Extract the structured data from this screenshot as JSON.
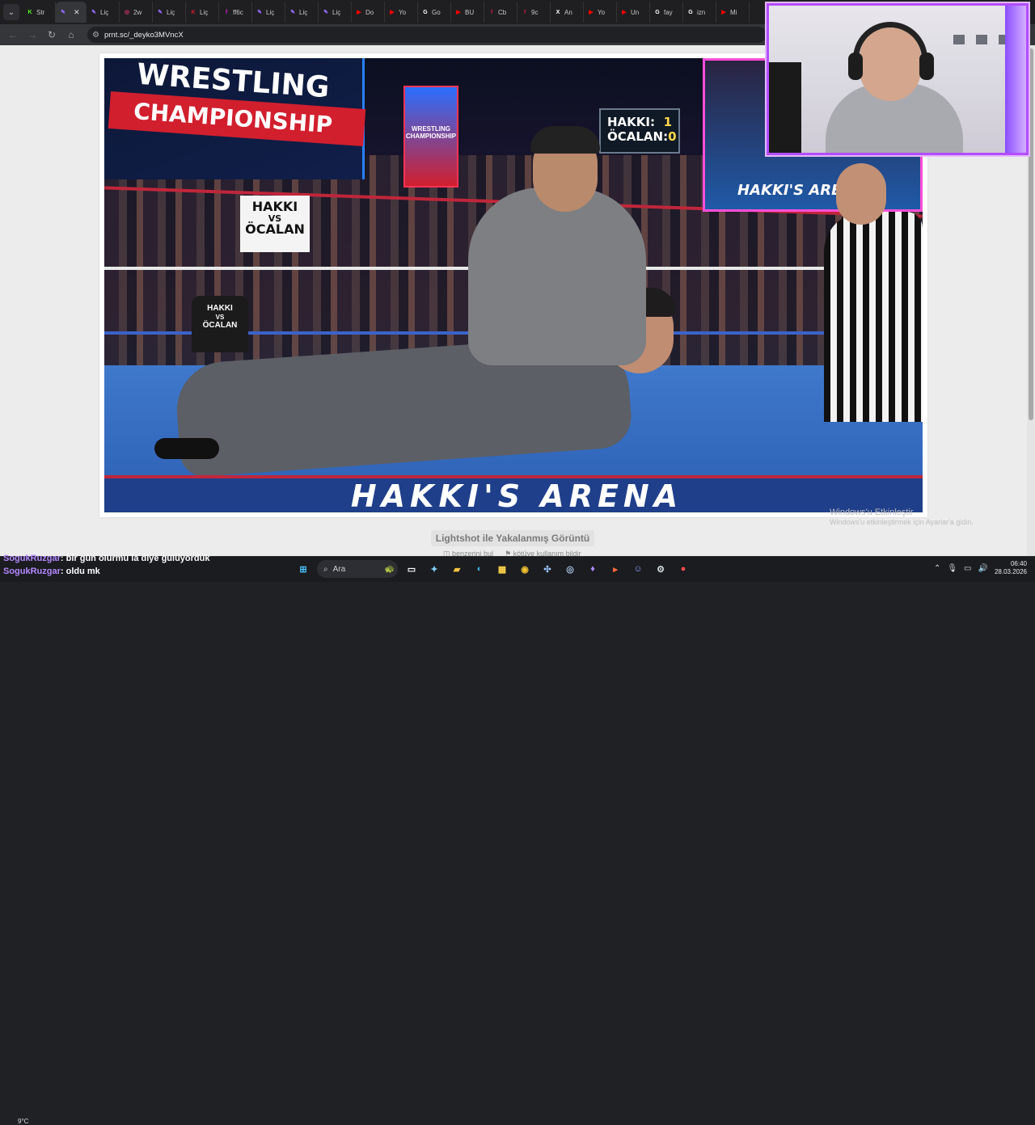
{
  "browser": {
    "tabs": [
      {
        "label": "Str",
        "icon": "kick-icon",
        "color": "#53fc18"
      },
      {
        "label": "",
        "icon": "lightshot-icon",
        "color": "#9a6bff",
        "active": true
      },
      {
        "label": "Liç",
        "icon": "lightshot-icon",
        "color": "#9a6bff"
      },
      {
        "label": "2w",
        "icon": "instagram-icon",
        "color": "#e1306c"
      },
      {
        "label": "Liç",
        "icon": "lightshot-icon",
        "color": "#9a6bff"
      },
      {
        "label": "Liç",
        "icon": "kick-icon",
        "color": "#d11f2e"
      },
      {
        "label": "ff6c",
        "icon": "letter-icon",
        "color": "#c21ec2"
      },
      {
        "label": "Liç",
        "icon": "lightshot-icon",
        "color": "#9a6bff"
      },
      {
        "label": "Liç",
        "icon": "lightshot-icon",
        "color": "#9a6bff"
      },
      {
        "label": "Liç",
        "icon": "lightshot-icon",
        "color": "#9a6bff"
      },
      {
        "label": "Do",
        "icon": "youtube-icon",
        "color": "#ff0000"
      },
      {
        "label": "Yo",
        "icon": "youtube-icon",
        "color": "#ff0000"
      },
      {
        "label": "Go",
        "icon": "google-icon",
        "color": "#ffffff"
      },
      {
        "label": "BU",
        "icon": "youtube-icon",
        "color": "#ff0000"
      },
      {
        "label": "Cb",
        "icon": "letter-icon",
        "color": "#c2183a"
      },
      {
        "label": "9c",
        "icon": "letter-icon",
        "color": "#c2183a"
      },
      {
        "label": "An",
        "icon": "x-icon",
        "color": "#ffffff"
      },
      {
        "label": "Yo",
        "icon": "youtube-icon",
        "color": "#ff0000"
      },
      {
        "label": "Un",
        "icon": "youtube-icon",
        "color": "#ff0000"
      },
      {
        "label": "fay",
        "icon": "google-icon",
        "color": "#ffffff"
      },
      {
        "label": "izn",
        "icon": "google-icon",
        "color": "#ffffff"
      },
      {
        "label": "Mi",
        "icon": "youtube-icon",
        "color": "#ff0000"
      }
    ],
    "url": "prnt.sc/_deyko3MVncX"
  },
  "screenshot": {
    "banner_line1": "WRESTLING",
    "banner_line2": "CHAMPIONSHIP",
    "poster_text": "WRESTLING CHAMPIONSHIP",
    "score": {
      "name1": "HAKKI:",
      "val1": "1",
      "name2": "ÖCALAN:",
      "val2": "0"
    },
    "sign_line1": "HAKKI",
    "sign_vs": "VS",
    "sign_line2": "ÖCALAN",
    "shirt_line1": "HAKKI",
    "shirt_vs": "VS",
    "shirt_line2": "ÖCALAN",
    "screen_text": "HAKKI'S ARENA",
    "mat_text": "HAKKI'S ARENA"
  },
  "page": {
    "caption": "Lightshot ile Yakalanmış Görüntü",
    "link_similar": "benzerini bul",
    "link_report": "kötüye kullanım bildir",
    "watermark_title": "Windows'u Etkinleştir",
    "watermark_sub": "Windows'u etkinleştirmek için Ayarlar'a gidin."
  },
  "chat": [
    {
      "user": "SogukRuzgar",
      "message": ": bir gün olurmu la diye gülüyorduk"
    },
    {
      "user": "SogukRuzgar",
      "message": ": oldu mk"
    }
  ],
  "taskbar": {
    "weather": "9°C",
    "search_placeholder": "Ara",
    "time": "06:40",
    "date": "28.03.2026"
  }
}
